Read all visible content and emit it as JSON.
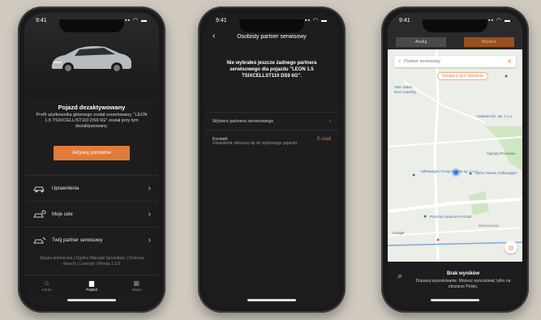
{
  "status": {
    "time": "9:41",
    "signal": "▪▪▪ ◠ ▬"
  },
  "phone1": {
    "title": "Pojazd dezaktywowany",
    "description": "Profil użytkownika głównego został zresetowany. \"LEON 1.5 TSIX/CELL/ST110 DS9 6G\" został przy tym dezaktywowany.",
    "activate_button": "Aktywuj ponownie",
    "menu": [
      {
        "label": "Uprawnienia",
        "icon": "car-key-icon"
      },
      {
        "label": "Moje cele",
        "icon": "car-location-icon"
      },
      {
        "label": "Twój partner serwisowy",
        "icon": "service-car-icon"
      }
    ],
    "legal": "Stopka techniczna | Ogólne Warunki Sprzedaży | Ochrona danych | Licencje | Wersja 1.1.0",
    "tabs": [
      {
        "label": "Konto",
        "icon": "user-icon"
      },
      {
        "label": "Pojazd",
        "icon": "car-icon",
        "active": true
      },
      {
        "label": "Mapa",
        "icon": "map-icon"
      }
    ]
  },
  "phone2": {
    "header": "Osobisty partner serwisowy",
    "back": "‹",
    "message": "Nie wybrałeś jeszcze żadnego partnera serwisowego dla pojazdu \"LEON 1.5 TSIXCELLST110 DS9 6G\".",
    "rows": [
      {
        "label": "Wybierz partnera serwisowego",
        "value": "›"
      },
      {
        "label": "Kontakt",
        "value": "E-mail"
      }
    ],
    "note": "Ustawienia odnoszą się do wybranego pojazdu"
  },
  "phone3": {
    "cancel": "Anuluj",
    "select": "Wybierz",
    "search_placeholder": "Partner serwisowy",
    "search_area": "Szukaj w tym obszarze",
    "map_labels": [
      "VDK Salon",
      "Dom Landing",
      "Gabinet NZ. Sp. z o.o.",
      "Ogrody Pruszków",
      "Volkswagen Group Polska sp. z o.o.",
      "Salon Serwis Volkswagen",
      "Porsche Centrum Poznań",
      "Warszawska",
      "Google"
    ],
    "no_results_title": "Brak wyników",
    "no_results_desc": "Dopasuj wyszukiwanie. Możesz wyszukiwać tylko na obszarze Polski."
  },
  "colors": {
    "accent": "#e07b39",
    "dark": "#1d1d1f"
  }
}
